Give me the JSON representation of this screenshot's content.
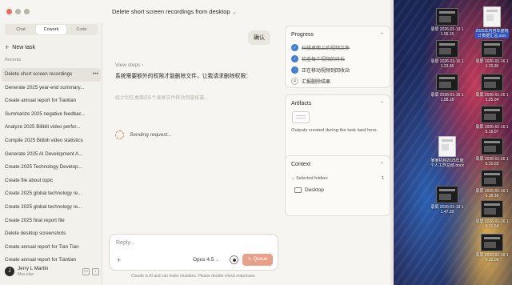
{
  "window": {
    "conversation_title": "Delete short screen recordings from desktop"
  },
  "sidebar": {
    "mode_tabs": [
      "Chat",
      "Cowork",
      "Code"
    ],
    "new_task_label": "New task",
    "recents_label": "Recents",
    "tasks": [
      "Delete short screen recordings",
      "Generate 2025 year-end summary...",
      "Create annual report for Tiantian",
      "Summarize 2025 negative feedbac...",
      "Analyze 2025 Bilibili video perfor...",
      "Compile 2025 Bilibili video statistics",
      "Generate 2025 AI Development A...",
      "Create 2025 Technology Develop...",
      "Create file about topic",
      "Create 2025 global technology re...",
      "Create 2025 global technology re...",
      "Create 2025 final report file",
      "Delete desktop screenshots",
      "Create annual report for Tian Tian",
      "Create annual report for Tiantian"
    ],
    "user": {
      "initial": "J",
      "name": "Jerry L Martin",
      "plan": "Max plan"
    }
  },
  "chat": {
    "user_message": "确认",
    "view_steps": "View steps",
    "assistant_message": "系统需要额外的权限才能删除文件，让我请求删除权限：",
    "faded_step": "经计划在桌面的5个录屏文件移动到废纸篓...",
    "status": "Sending request...",
    "composer": {
      "placeholder": "Reply...",
      "model": "Opus 4.5",
      "queue_label": "Queue"
    },
    "disclaimer": "Claude is AI and can make mistakes. Please double-check responses."
  },
  "progress": {
    "title": "Progress",
    "steps": [
      {
        "label": "扫描桌面上的视频文件",
        "state": "done"
      },
      {
        "label": "检查每个视频的时长",
        "state": "done"
      },
      {
        "label": "正在移动视频到回收站",
        "state": "active"
      },
      {
        "num": "4",
        "label": "汇报删除结果",
        "state": "pending"
      }
    ]
  },
  "artifacts": {
    "title": "Artifacts",
    "description": "Outputs created during the task land here."
  },
  "context": {
    "title": "Context",
    "selected_label": "Selected folders",
    "count": "1",
    "folder": "Desktop"
  },
  "desktop": {
    "icons": [
      {
        "label": "录屏 2026-01-19 11.05.15",
        "type": "video"
      },
      {
        "label": "2025年内容年度统计数据汇总.xlsx",
        "type": "doc"
      },
      {
        "label": "录屏 2026-01-16 11.23.36",
        "type": "video"
      },
      {
        "label": "录屏 2026-01-16 11.20.30",
        "type": "video"
      },
      {
        "label": "录屏 2026-01-16 11.58.18",
        "type": "video"
      },
      {
        "label": "录屏 2026-01-16 11.25.04",
        "type": "video"
      },
      {
        "label": "录屏 2026-01-16 15.16.07",
        "type": "video"
      },
      {
        "label": "某某机构2025年度个人工作总结.docx",
        "type": "doc"
      },
      {
        "label": "录屏 2026-01-16 16.10.03",
        "type": "video"
      },
      {
        "label": "录屏 2026-01-16 16.36.38",
        "type": "video"
      },
      {
        "label": "录屏 2026-01-19 11.47.39",
        "type": "video"
      },
      {
        "label": "录屏 2026-01-16 10.31.54",
        "type": "video"
      },
      {
        "label": "录屏 2026-01-16 10.32.08",
        "type": "video"
      }
    ]
  }
}
